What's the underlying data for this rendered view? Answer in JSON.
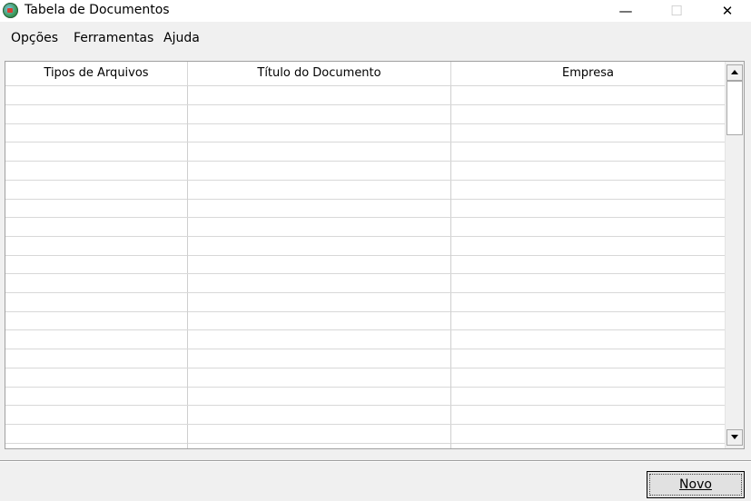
{
  "window": {
    "title": "Tabela de Documentos",
    "minimize_glyph": "—",
    "maximize_glyph": "☐",
    "close_glyph": "✕"
  },
  "menu": {
    "items": [
      "Opções",
      "Ferramentas",
      "Ajuda"
    ]
  },
  "table": {
    "columns": [
      "Tipos de Arquivos",
      "Título do Documento",
      "Empresa"
    ],
    "rows": [
      [
        "",
        "",
        ""
      ],
      [
        "",
        "",
        ""
      ],
      [
        "",
        "",
        ""
      ],
      [
        "",
        "",
        ""
      ],
      [
        "",
        "",
        ""
      ],
      [
        "",
        "",
        ""
      ],
      [
        "",
        "",
        ""
      ],
      [
        "",
        "",
        ""
      ],
      [
        "",
        "",
        ""
      ],
      [
        "",
        "",
        ""
      ],
      [
        "",
        "",
        ""
      ],
      [
        "",
        "",
        ""
      ],
      [
        "",
        "",
        ""
      ],
      [
        "",
        "",
        ""
      ],
      [
        "",
        "",
        ""
      ],
      [
        "",
        "",
        ""
      ],
      [
        "",
        "",
        ""
      ],
      [
        "",
        "",
        ""
      ],
      [
        "",
        "",
        ""
      ],
      [
        "",
        "",
        ""
      ]
    ]
  },
  "actions": {
    "novo_label": "Novo"
  },
  "icons": {
    "app": "app-globe-icon",
    "scroll_up": "scroll-up-arrow-icon",
    "scroll_down": "scroll-down-arrow-icon"
  }
}
